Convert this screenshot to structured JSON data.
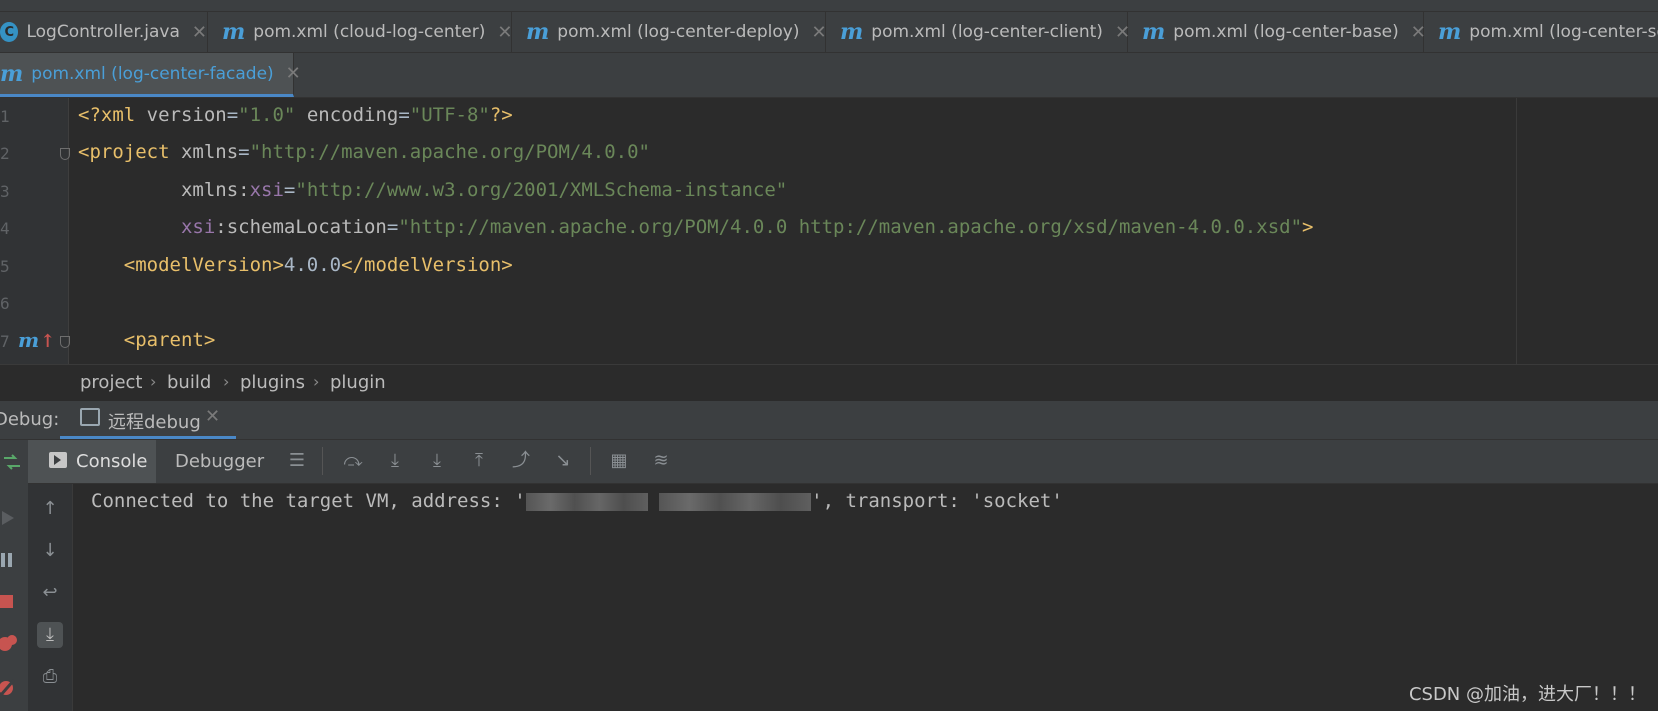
{
  "tabs_row1": [
    {
      "icon": "c",
      "label": "LogController.java"
    },
    {
      "icon": "m",
      "label": "pom.xml (cloud-log-center)"
    },
    {
      "icon": "m",
      "label": "pom.xml (log-center-deploy)"
    },
    {
      "icon": "m",
      "label": "pom.xml (log-center-client)"
    },
    {
      "icon": "m",
      "label": "pom.xml (log-center-base)"
    },
    {
      "icon": "m",
      "label": "pom.xml (log-center-se"
    }
  ],
  "tab_active": {
    "icon": "m",
    "label": "pom.xml (log-center-facade)"
  },
  "editor": {
    "line_numbers": [
      "1",
      "2",
      "3",
      "4",
      "5",
      "6",
      "7"
    ],
    "lines": {
      "l1_open": "<?xml ",
      "l1_a1": "version",
      "l1_eq1": "=",
      "l1_v1": "\"1.0\"",
      "l1_a2": " encoding",
      "l1_eq2": "=",
      "l1_v2": "\"UTF-8\"",
      "l1_close": "?>",
      "l2_tag": "<project ",
      "l2_attr": "xmlns",
      "l2_eq": "=",
      "l2_val": "\"http://maven.apache.org/POM/4.0.0\"",
      "l3_indent": "         ",
      "l3_attr": "xmlns:",
      "l3_ns": "xsi",
      "l3_eq": "=",
      "l3_val": "\"http://www.w3.org/2001/XMLSchema-instance\"",
      "l4_indent": "         ",
      "l4_ns": "xsi",
      "l4_attr": ":schemaLocation",
      "l4_eq": "=",
      "l4_val": "\"http://maven.apache.org/POM/4.0.0 http://maven.apache.org/xsd/maven-4.0.0.xsd\"",
      "l4_close": ">",
      "l5_indent": "    ",
      "l5_open": "<modelVersion>",
      "l5_text": "4.0.0",
      "l5_close": "</modelVersion>",
      "l7_indent": "    ",
      "l7_tag": "<parent>"
    },
    "gutter_marker": "m"
  },
  "breadcrumb": [
    "project",
    "build",
    "plugins",
    "plugin"
  ],
  "debug": {
    "label": "Debug:",
    "session": "远程debug",
    "tabs": {
      "console": "Console",
      "debugger": "Debugger"
    },
    "console_prefix": "Connected to the target VM, address: '",
    "console_suffix": "', transport: 'socket'"
  },
  "watermark": "CSDN @加油，进大厂！！！"
}
